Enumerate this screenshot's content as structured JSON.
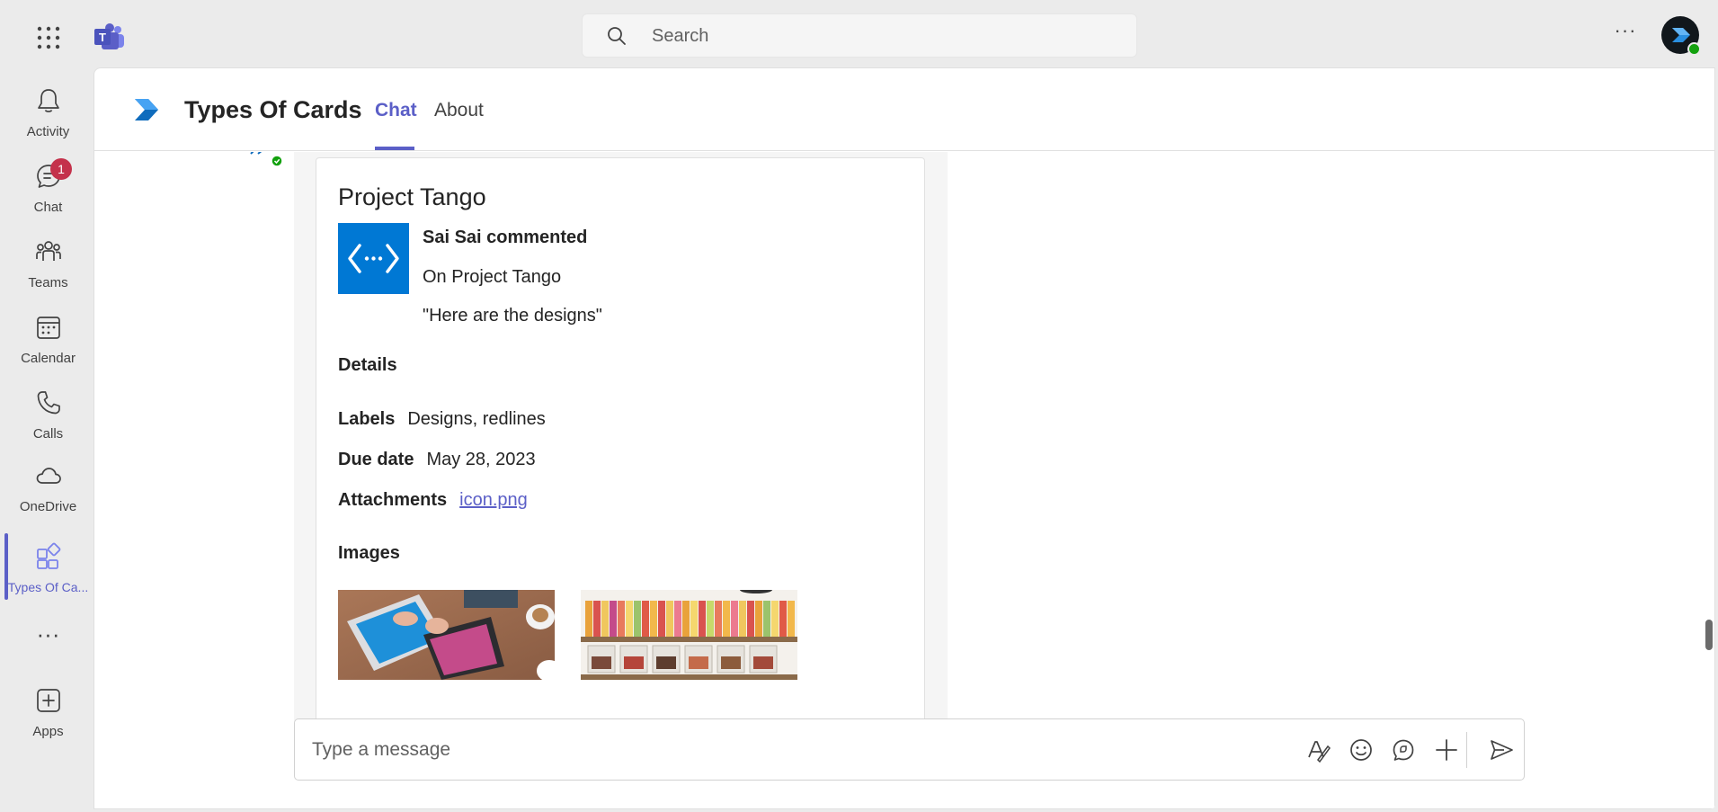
{
  "topbar": {
    "search_placeholder": "Search",
    "more_icon": "ellipsis-icon"
  },
  "rail": {
    "items": [
      {
        "label": "Activity",
        "icon": "bell-icon"
      },
      {
        "label": "Chat",
        "icon": "chat-icon",
        "badge": "1"
      },
      {
        "label": "Teams",
        "icon": "teams-icon"
      },
      {
        "label": "Calendar",
        "icon": "calendar-icon"
      },
      {
        "label": "Calls",
        "icon": "phone-icon"
      },
      {
        "label": "OneDrive",
        "icon": "cloud-icon"
      },
      {
        "label": "Types Of Ca...",
        "icon": "app-grid-icon",
        "active": true
      },
      {
        "label": "Apps",
        "icon": "add-app-icon"
      }
    ]
  },
  "header": {
    "title": "Types Of Cards",
    "tabs": [
      {
        "label": "Chat",
        "active": true
      },
      {
        "label": "About",
        "active": false
      }
    ]
  },
  "card": {
    "title": "Project Tango",
    "comment": {
      "author_line": "Sai Sai commented",
      "context_line": "On Project Tango",
      "quote_line": "\"Here are the designs\""
    },
    "details_heading": "Details",
    "facts": [
      {
        "key": "Labels",
        "value": "Designs, redlines"
      },
      {
        "key": "Due date",
        "value": "May 28, 2023"
      },
      {
        "key": "Attachments",
        "value": "icon.png",
        "link": true
      }
    ],
    "images_heading": "Images"
  },
  "compose": {
    "placeholder": "Type a message"
  },
  "colors": {
    "accent": "#5b5fc7",
    "badge": "#c4314b",
    "brand_blue": "#0078d4",
    "presence": "#13a10e"
  }
}
